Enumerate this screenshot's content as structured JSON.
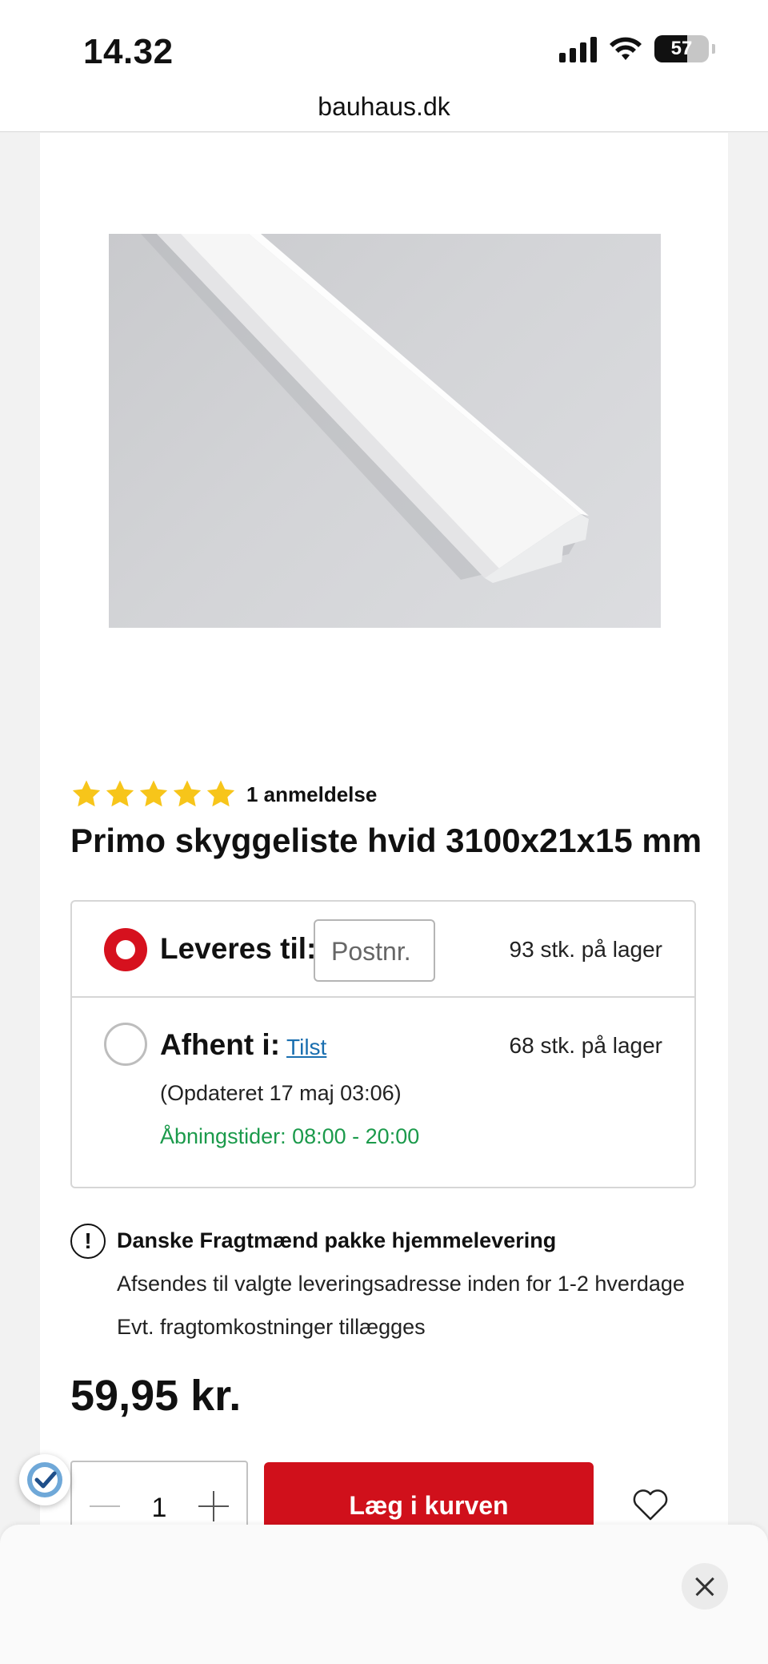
{
  "status_bar": {
    "time": "14.32",
    "battery": "57"
  },
  "browser": {
    "url": "bauhaus.dk"
  },
  "product": {
    "review_count_label": "1 anmeldelse",
    "rating": 5,
    "title": "Primo skyggeliste hvid 3100x21x15 mm",
    "price": "59,95 kr."
  },
  "delivery": {
    "option_deliver": {
      "label": "Leveres til:",
      "selected": true,
      "stock": "93 stk. på lager"
    },
    "postnr_placeholder": "Postnr.",
    "option_pickup": {
      "label": "Afhent i:",
      "store": "Tilst",
      "selected": false,
      "stock": "68 stk. på lager",
      "updated": "(Opdateret 17 maj 03:06)",
      "hours": "Åbningstider: 08:00 - 20:00"
    }
  },
  "notice": {
    "title": "Danske Fragtmænd pakke hjemmelevering",
    "line1": "Afsendes til valgte leveringsadresse inden for 1-2 hverdage",
    "line2": "Evt. fragtomkostninger tillægges"
  },
  "cart": {
    "quantity": "1",
    "add_label": "Læg i kurven"
  },
  "colors": {
    "brand_red": "#d0101b",
    "star_yellow": "#f7c51a",
    "green": "#1b9a4b",
    "link_blue": "#1a6fb0"
  }
}
